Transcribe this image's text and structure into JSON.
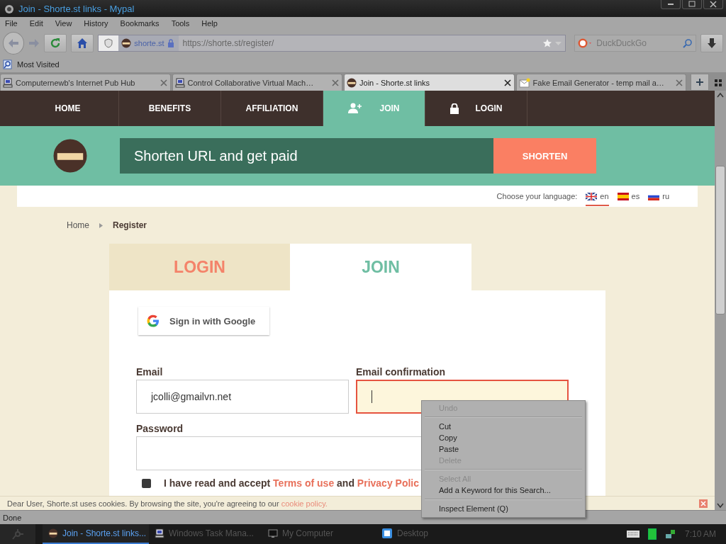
{
  "window": {
    "title": "Join - Shorte.st links - Mypal"
  },
  "menu_bar": [
    "File",
    "Edit",
    "View",
    "History",
    "Bookmarks",
    "Tools",
    "Help"
  ],
  "toolbar": {
    "site_identity": "shorte.st",
    "url": "https://shorte.st/register/",
    "search_placeholder": "DuckDuckGo"
  },
  "bookmarks": [
    "Most Visited"
  ],
  "tabs": [
    {
      "label": "Computernewb's Internet Pub Hub",
      "selected": false
    },
    {
      "label": "Control Collaborative Virtual Mach…",
      "selected": false
    },
    {
      "label": "Join - Shorte.st links",
      "selected": true
    },
    {
      "label": "Fake Email Generator - temp mail a…",
      "selected": false
    }
  ],
  "site_nav": [
    {
      "label": "HOME",
      "selected": false
    },
    {
      "label": "BENEFITS",
      "selected": false
    },
    {
      "label": "AFFILIATION",
      "selected": false
    },
    {
      "label": "JOIN",
      "selected": true
    },
    {
      "label": "LOGIN",
      "selected": false
    }
  ],
  "banner": {
    "placeholder": "Shorten URL and get paid",
    "button": "SHORTEN"
  },
  "language": {
    "label": "Choose your language:",
    "options": [
      {
        "code": "en",
        "selected": true
      },
      {
        "code": "es",
        "selected": false
      },
      {
        "code": "ru",
        "selected": false
      }
    ]
  },
  "breadcrumb": [
    "Home",
    "Register"
  ],
  "form_tabs": [
    {
      "label": "LOGIN",
      "selected": false
    },
    {
      "label": "JOIN",
      "selected": true
    }
  ],
  "google_button": "Sign in with Google",
  "fields": [
    {
      "label": "Email",
      "value": "jcolli@gmailvn.net",
      "focused": false
    },
    {
      "label": "Email confirmation",
      "focused": true
    },
    {
      "label": "Password",
      "focused": false
    }
  ],
  "terms": {
    "checked": false,
    "parts": [
      {
        "kind": "plain",
        "text": "I have read and accept "
      },
      {
        "kind": "link",
        "text": "Terms of use"
      },
      {
        "kind": "plain",
        "text": " and "
      },
      {
        "kind": "link",
        "text": "Privacy Polic"
      }
    ]
  },
  "cookie_bar": {
    "text": "Dear User, Shorte.st uses cookies. By browsing the site, you're agreeing to our ",
    "link": "cookie policy."
  },
  "context_menu": [
    {
      "kind": "item",
      "label": "Undo",
      "disabled": true
    },
    {
      "kind": "separator"
    },
    {
      "kind": "item",
      "label": "Cut",
      "disabled": false
    },
    {
      "kind": "item",
      "label": "Copy",
      "disabled": false
    },
    {
      "kind": "item",
      "label": "Paste",
      "disabled": false
    },
    {
      "kind": "item",
      "label": "Delete",
      "disabled": true
    },
    {
      "kind": "separator"
    },
    {
      "kind": "item",
      "label": "Select All",
      "disabled": true
    },
    {
      "kind": "item",
      "label": "Add a Keyword for this Search...",
      "disabled": false
    },
    {
      "kind": "separator"
    },
    {
      "kind": "item",
      "label": "Inspect Element (Q)",
      "disabled": false
    }
  ],
  "status_bar": "Done",
  "taskbar": {
    "items": [
      {
        "label": "Join - Shorte.st links...",
        "selected": true
      },
      {
        "label": "Windows Task Mana...",
        "selected": false
      },
      {
        "label": "My Computer",
        "selected": false
      },
      {
        "label": "Desktop",
        "selected": false
      }
    ],
    "clock": "7:10 AM"
  }
}
